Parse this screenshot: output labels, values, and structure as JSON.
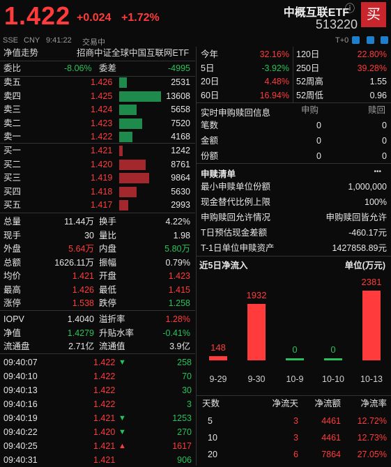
{
  "header": {
    "price": "1.422",
    "change": "+0.024",
    "change_pct": "+1.72%",
    "name": "中概互联ETF",
    "code": "513220",
    "buy_label": "买",
    "info_icon": "ⓘ"
  },
  "subbar": {
    "exchange": "SSE",
    "currency": "CNY",
    "time": "9:41:22",
    "status": "交易中",
    "settle": "T+0"
  },
  "nav": {
    "label": "净值走势",
    "index": "招商中证全球中国互联网ETF"
  },
  "ratio": {
    "weibi_label": "委比",
    "weibi": "-8.06%",
    "weicha_label": "委差",
    "weicha": "-4995"
  },
  "sell_orders": [
    {
      "label": "卖五",
      "price": "1.426",
      "vol": "2531",
      "fill": 0.19
    },
    {
      "label": "卖四",
      "price": "1.425",
      "vol": "13608",
      "fill": 1.0
    },
    {
      "label": "卖三",
      "price": "1.424",
      "vol": "5658",
      "fill": 0.42
    },
    {
      "label": "卖二",
      "price": "1.423",
      "vol": "7520",
      "fill": 0.55
    },
    {
      "label": "卖一",
      "price": "1.422",
      "vol": "4168",
      "fill": 0.31
    }
  ],
  "buy_orders": [
    {
      "label": "买一",
      "price": "1.421",
      "vol": "1242",
      "fill": 0.09
    },
    {
      "label": "买二",
      "price": "1.420",
      "vol": "8761",
      "fill": 0.64
    },
    {
      "label": "买三",
      "price": "1.419",
      "vol": "9864",
      "fill": 0.72
    },
    {
      "label": "买四",
      "price": "1.418",
      "vol": "5630",
      "fill": 0.41
    },
    {
      "label": "买五",
      "price": "1.417",
      "vol": "2993",
      "fill": 0.22
    }
  ],
  "stats": [
    {
      "l1": "总量",
      "v1": "11.44万",
      "c1": "white",
      "l2": "换手",
      "v2": "4.22%",
      "c2": "white"
    },
    {
      "l1": "现手",
      "v1": "30",
      "c1": "white",
      "l2": "量比",
      "v2": "1.98",
      "c2": "white"
    },
    {
      "l1": "外盘",
      "v1": "5.64万",
      "c1": "red",
      "l2": "内盘",
      "v2": "5.80万",
      "c2": "green"
    },
    {
      "l1": "总额",
      "v1": "1626.11万",
      "c1": "white",
      "l2": "振幅",
      "v2": "0.79%",
      "c2": "white"
    },
    {
      "l1": "均价",
      "v1": "1.421",
      "c1": "red",
      "l2": "开盘",
      "v2": "1.423",
      "c2": "red"
    },
    {
      "l1": "最高",
      "v1": "1.426",
      "c1": "red",
      "l2": "最低",
      "v2": "1.415",
      "c2": "red"
    },
    {
      "l1": "涨停",
      "v1": "1.538",
      "c1": "red",
      "l2": "跌停",
      "v2": "1.258",
      "c2": "green"
    }
  ],
  "iopv": [
    {
      "l1": "IOPV",
      "v1": "1.4040",
      "c1": "white",
      "l2": "溢折率",
      "v2": "1.28%",
      "c2": "red"
    },
    {
      "l1": "净值",
      "v1": "1.4279",
      "c1": "green",
      "l2": "升贴水率",
      "v2": "-0.41%",
      "c2": "green"
    },
    {
      "l1": "流通盘",
      "v1": "2.71亿",
      "c1": "white",
      "l2": "流通值",
      "v2": "3.9亿",
      "c2": "white"
    }
  ],
  "ticks": [
    {
      "time": "09:40:07",
      "price": "1.422",
      "dir": "down",
      "vol": "258",
      "vc": "green"
    },
    {
      "time": "09:40:10",
      "price": "1.422",
      "dir": "",
      "vol": "70",
      "vc": "green"
    },
    {
      "time": "09:40:13",
      "price": "1.422",
      "dir": "",
      "vol": "30",
      "vc": "green"
    },
    {
      "time": "09:40:16",
      "price": "1.422",
      "dir": "",
      "vol": "3",
      "vc": "green"
    },
    {
      "time": "09:40:19",
      "price": "1.421",
      "dir": "down",
      "vol": "1253",
      "vc": "green"
    },
    {
      "time": "09:40:22",
      "price": "1.420",
      "dir": "down",
      "vol": "270",
      "vc": "green"
    },
    {
      "time": "09:40:25",
      "price": "1.421",
      "dir": "up",
      "vol": "1617",
      "vc": "red"
    },
    {
      "time": "09:40:31",
      "price": "1.421",
      "dir": "",
      "vol": "906",
      "vc": "green"
    }
  ],
  "perf": [
    {
      "l1": "今年",
      "v1": "32.16%",
      "c1": "red",
      "l2": "120日",
      "v2": "22.80%",
      "c2": "red"
    },
    {
      "l1": "5日",
      "v1": "-3.92%",
      "c1": "green",
      "l2": "250日",
      "v2": "39.28%",
      "c2": "red"
    },
    {
      "l1": "20日",
      "v1": "4.48%",
      "c1": "red",
      "l2": "52周高",
      "v2": "1.55",
      "c2": "white"
    },
    {
      "l1": "60日",
      "v1": "16.94%",
      "c1": "red",
      "l2": "52周低",
      "v2": "0.96",
      "c2": "white"
    }
  ],
  "realtime": {
    "title": "实时申购赎回信息",
    "col1": "申购",
    "col2": "赎回",
    "rows": [
      {
        "label": "笔数",
        "a": "0",
        "b": "0"
      },
      {
        "label": "金额",
        "a": "0",
        "b": "0"
      },
      {
        "label": "份额",
        "a": "0",
        "b": "0"
      }
    ]
  },
  "creation": {
    "title": "申赎清单",
    "more": "•••",
    "rows": [
      {
        "label": "最小申赎单位份额",
        "value": "1,000,000"
      },
      {
        "label": "现金替代比例上限",
        "value": "100%"
      },
      {
        "label": "申购赎回允许情况",
        "value": "申购赎回皆允许"
      },
      {
        "label": "T日预估现金差额",
        "value": "-460.17元"
      },
      {
        "label": "T-1日单位申赎资产",
        "value": "1427858.89元"
      }
    ]
  },
  "flow": {
    "title": "近5日净流入",
    "unit": "单位(万元)"
  },
  "chart_data": {
    "type": "bar",
    "title": "近5日净流入",
    "ylabel": "单位(万元)",
    "categories": [
      "9-29",
      "9-30",
      "10-9",
      "10-10",
      "10-13"
    ],
    "values": [
      148,
      1932,
      0,
      0,
      2381
    ],
    "colors": [
      "#ff3b3b",
      "#ff3b3b",
      "#29c25a",
      "#29c25a",
      "#ff3b3b"
    ]
  },
  "flow_table": {
    "headers": [
      "天数",
      "净流天",
      "净流额",
      "净流率"
    ],
    "rows": [
      {
        "days": "5",
        "net_days": "3",
        "amount": "4461",
        "rate": "12.72%"
      },
      {
        "days": "10",
        "net_days": "3",
        "amount": "4461",
        "rate": "12.73%"
      },
      {
        "days": "20",
        "net_days": "6",
        "amount": "7864",
        "rate": "27.05%"
      }
    ]
  }
}
